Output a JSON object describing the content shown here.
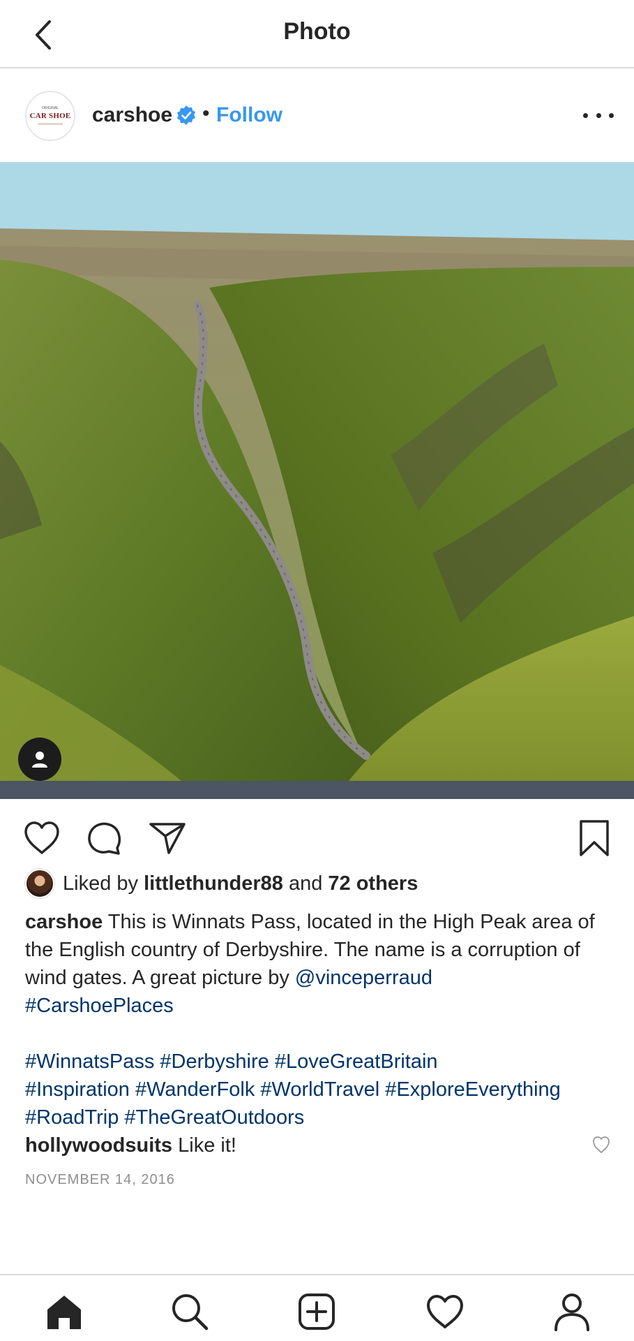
{
  "topbar": {
    "title": "Photo"
  },
  "post": {
    "username": "carshoe",
    "follow_label": "Follow",
    "separator": "•",
    "avatar_logo_text": "CAR SHOE",
    "avatar_logo_subtext": "ORIGINAL"
  },
  "likes": {
    "prefix": "Liked by",
    "liker": "littlethunder88",
    "and": "and",
    "others": "72 others"
  },
  "caption": {
    "username": "carshoe",
    "text": " This is Winnats Pass, located in the High Peak area of the English country of Derbyshire. The name is a corruption of wind gates. A great picture by ",
    "mention": "@vinceperraud",
    "hashtag": "#CarshoePlaces",
    "hashtags_line1": "#WinnatsPass #Derbyshire #LoveGreatBritain",
    "hashtags_line2": "#Inspiration #WanderFolk #WorldTravel #ExploreEverything",
    "hashtags_line3": "#RoadTrip #TheGreatOutdoors"
  },
  "comment": {
    "username": "hollywoodsuits",
    "text": " Like it!"
  },
  "date": "NOVEMBER 14, 2016",
  "icons": {
    "back": "back-arrow-icon",
    "verified": "verified-badge-icon",
    "more": "more-options-icon",
    "like": "heart-icon",
    "comment": "comment-bubble-icon",
    "share": "paper-plane-icon",
    "save": "bookmark-icon",
    "tag": "person-tag-icon",
    "home": "home-icon",
    "search": "search-icon",
    "add": "add-post-icon",
    "activity": "heart-icon",
    "profile": "profile-icon"
  },
  "colors": {
    "accent": "#3897f0",
    "link": "#003569",
    "muted": "#8e8e8e",
    "text": "#262626",
    "border": "#dbdbdb"
  }
}
